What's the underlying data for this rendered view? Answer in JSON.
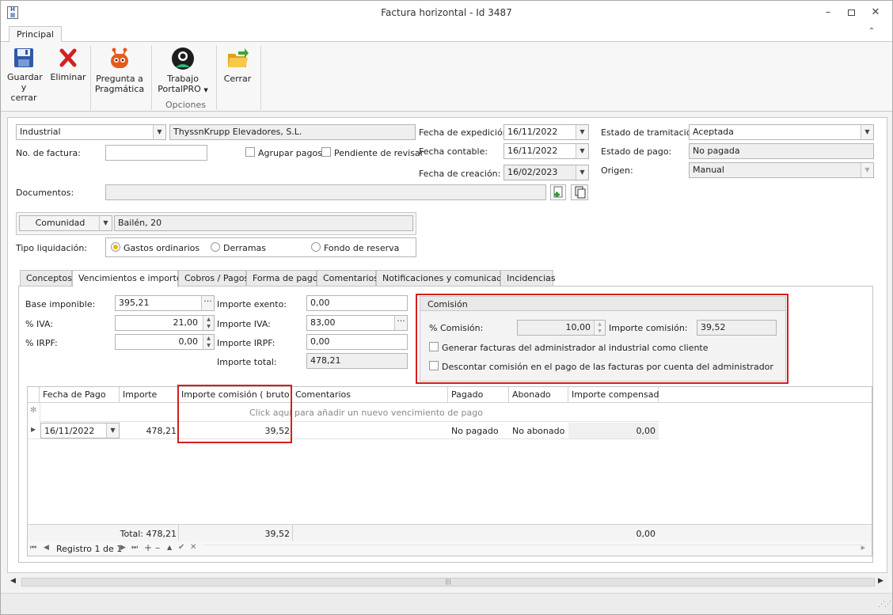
{
  "window": {
    "title": "Factura horizontal - Id 3487",
    "app_icon": "invoice-app-icon"
  },
  "ribbon": {
    "tab": "Principal",
    "buttons": {
      "save_line1": "Guardar",
      "save_line2": "y cerrar",
      "delete": "Eliminar",
      "ask_line1": "Pregunta a",
      "ask_line2": "Pragmática",
      "work_line1": "Trabajo",
      "work_line2": "PortalPRO",
      "close": "Cerrar"
    },
    "group_label": "Opciones"
  },
  "header": {
    "type": "Industrial",
    "supplier": "ThyssnKrupp Elevadores, S.L.",
    "invoice_no_label": "No. de factura:",
    "invoice_no": "",
    "group_payments": "Agrupar pagos",
    "pending_review": "Pendiente de revisar",
    "issue_date_label": "Fecha de expedición:",
    "issue_date": "16/11/2022",
    "accounting_date_label": "Fecha contable:",
    "accounting_date": "16/11/2022",
    "creation_date_label": "Fecha de creación:",
    "creation_date": "16/02/2023",
    "processing_state_label": "Estado de tramitación:",
    "processing_state": "Aceptada",
    "payment_state_label": "Estado de pago:",
    "payment_state": "No pagada",
    "origin_label": "Origen:",
    "origin": "Manual",
    "documents_label": "Documentos:",
    "documents": "",
    "community_type": "Comunidad",
    "community": "Bailén, 20",
    "liquidation_label": "Tipo liquidación:",
    "liquidation_options": [
      "Gastos ordinarios",
      "Derramas",
      "Fondo de reserva"
    ],
    "liquidation_selected": 0
  },
  "tabs": [
    "Conceptos",
    "Vencimientos e importes",
    "Cobros / Pagos",
    "Forma de pago",
    "Comentarios",
    "Notificaciones y comunicados",
    "Incidencias"
  ],
  "active_tab": 1,
  "amounts": {
    "base_label": "Base imponible:",
    "base": "395,21",
    "iva_pct_label": "% IVA:",
    "iva_pct": "21,00",
    "irpf_pct_label": "% IRPF:",
    "irpf_pct": "0,00",
    "exempt_label": "Importe exento:",
    "exempt": "0,00",
    "iva_label": "Importe IVA:",
    "iva": "83,00",
    "irpf_label": "Importe IRPF:",
    "irpf": "0,00",
    "total_label": "Importe total:",
    "total": "478,21"
  },
  "commission": {
    "title": "Comisión",
    "pct_label": "% Comisión:",
    "pct": "10,00",
    "amount_label": "Importe comisión:",
    "amount": "39,52",
    "generate_invoices": "Generar facturas del administrador al industrial como cliente",
    "discount_commission": "Descontar comisión en el pago de las facturas por cuenta del administrador"
  },
  "grid": {
    "columns": [
      "Fecha de Pago",
      "Importe",
      "Importe comisión ( bruto )",
      "Comentarios",
      "Pagado",
      "Abonado",
      "Importe compensado"
    ],
    "new_row_hint": "Click aquí para añadir un nuevo vencimiento de pago",
    "rows": [
      {
        "date": "16/11/2022",
        "amount": "478,21",
        "commission": "39,52",
        "comments": "",
        "paid": "No pagado",
        "credited": "No abonado",
        "compensated": "0,00"
      }
    ],
    "footer": {
      "total": "Total: 478,21",
      "commission_total": "39,52",
      "compensated_total": "0,00"
    },
    "navigator": "Registro 1 de 1"
  }
}
